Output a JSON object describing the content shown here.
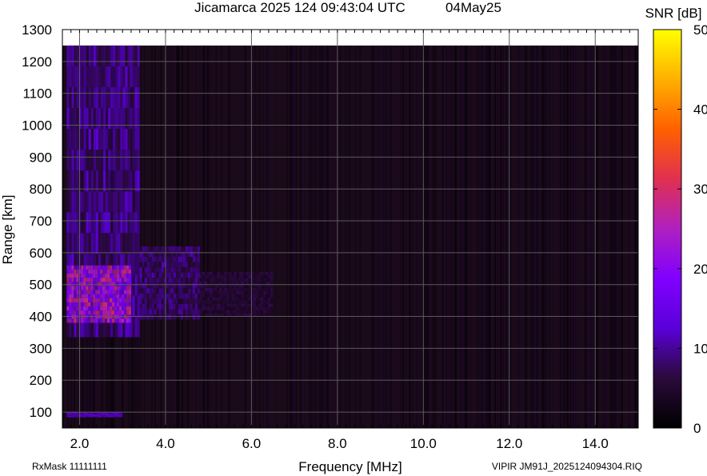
{
  "header": {
    "title": "Jicamarca 2025 124 09:43:04 UTC",
    "date": "04May25"
  },
  "footer": {
    "rxmask": "RxMask 11111111",
    "file": "VIPIR  JM91J_2025124094304.RIQ"
  },
  "chart_data": {
    "type": "heatmap",
    "title": "Jicamarca 2025 124 09:43:04 UTC",
    "xlabel": "Frequency [MHz]",
    "ylabel": "Range [km]",
    "xlim": [
      1.6,
      15.0
    ],
    "ylim": [
      50,
      1300
    ],
    "x_ticks": [
      "2.0",
      "4.0",
      "6.0",
      "8.0",
      "10.0",
      "12.0",
      "14.0"
    ],
    "x_tick_values": [
      2,
      4,
      6,
      8,
      10,
      12,
      14
    ],
    "y_ticks": [
      "100",
      "200",
      "300",
      "400",
      "500",
      "600",
      "700",
      "800",
      "900",
      "1000",
      "1100",
      "1200",
      "1300"
    ],
    "y_tick_values": [
      100,
      200,
      300,
      400,
      500,
      600,
      700,
      800,
      900,
      1000,
      1100,
      1200,
      1300
    ],
    "colorbar": {
      "label": "SNR [dB]",
      "range": [
        0,
        50
      ],
      "ticks": [
        "0",
        "10",
        "20",
        "30",
        "40",
        "50"
      ],
      "tick_values": [
        0,
        10,
        20,
        30,
        40,
        50
      ],
      "colormap": [
        "#000000",
        "#2a0a3a",
        "#5a00d8",
        "#8000ff",
        "#b020c0",
        "#e03050",
        "#ff6000",
        "#ffb000",
        "#ffff00"
      ]
    },
    "grid": true,
    "traces": [
      {
        "f_start": 1.7,
        "f_end": 3.4,
        "r_min": 335,
        "r_max": 1250,
        "snr": 10
      },
      {
        "f_start": 1.7,
        "f_end": 3.2,
        "r_min": 380,
        "r_max": 560,
        "snr": 24
      },
      {
        "f_start": 3.4,
        "f_end": 4.8,
        "r_min": 390,
        "r_max": 620,
        "snr": 9
      },
      {
        "f_start": 4.8,
        "f_end": 6.5,
        "r_min": 400,
        "r_max": 540,
        "snr": 6
      },
      {
        "f_start": 1.7,
        "f_end": 3.0,
        "r_min": 85,
        "r_max": 100,
        "snr": 12
      }
    ]
  },
  "colors": {
    "background": "#ffffff",
    "plot_background": "#1a0a1a",
    "grid": "#5a5a5a"
  }
}
